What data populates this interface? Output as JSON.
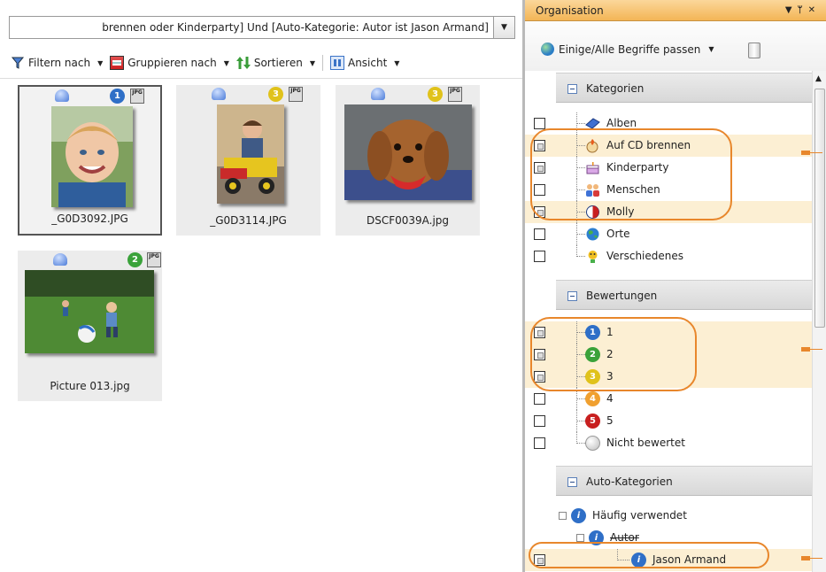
{
  "search": {
    "query": "brennen oder Kinderparty] Und [Auto-Kategorie: Autor ist Jason Armand]"
  },
  "toolbar": {
    "filter_label": "Filtern nach",
    "group_label": "Gruppieren nach",
    "sort_label": "Sortieren",
    "view_label": "Ansicht"
  },
  "photos": [
    {
      "filename": "_G0D3092.JPG",
      "rating": "1",
      "rating_color": "#2f6fc7",
      "selected": true
    },
    {
      "filename": "_G0D3114.JPG",
      "rating": "3",
      "rating_color": "#e0c21b",
      "selected": false
    },
    {
      "filename": "DSCF0039A.jpg",
      "rating": "3",
      "rating_color": "#e0c21b",
      "selected": false
    },
    {
      "filename": "Picture 013.jpg",
      "rating": "2",
      "rating_color": "#3aa23a",
      "selected": false
    }
  ],
  "badges": {
    "jpg": "JPG"
  },
  "panel": {
    "title": "Organisation",
    "match_label": "Einige/Alle Begriffe passen",
    "accent": "#e8872c"
  },
  "sections": {
    "categories": {
      "title": "Kategorien",
      "items": [
        {
          "label": "Alben",
          "icon": "album-icon",
          "highlighted": false,
          "checked": false
        },
        {
          "label": "Auf CD brennen",
          "icon": "burn-cd-icon",
          "highlighted": true,
          "checked": true
        },
        {
          "label": "Kinderparty",
          "icon": "cake-icon",
          "highlighted": false,
          "checked": true
        },
        {
          "label": "Menschen",
          "icon": "people-icon",
          "highlighted": false,
          "checked": false
        },
        {
          "label": "Molly",
          "icon": "molly-icon",
          "highlighted": true,
          "checked": true
        },
        {
          "label": "Orte",
          "icon": "globe-icon",
          "highlighted": false,
          "checked": false
        },
        {
          "label": "Verschiedenes",
          "icon": "misc-icon",
          "highlighted": false,
          "checked": false
        }
      ]
    },
    "ratings": {
      "title": "Bewertungen",
      "items": [
        {
          "label": "1",
          "number": "1",
          "color": "#2f6fc7",
          "checked": true
        },
        {
          "label": "2",
          "number": "2",
          "color": "#3aa23a",
          "checked": true
        },
        {
          "label": "3",
          "number": "3",
          "color": "#e0c21b",
          "checked": true
        },
        {
          "label": "4",
          "number": "4",
          "color": "#f0a030",
          "checked": false
        },
        {
          "label": "5",
          "number": "5",
          "color": "#c81f1f",
          "checked": false
        },
        {
          "label": "Nicht bewertet",
          "number": "",
          "color": "#cfcfcf",
          "checked": false
        }
      ]
    },
    "auto": {
      "title": "Auto-Kategorien",
      "items": [
        {
          "label": "Häufig verwendet"
        },
        {
          "label": "Autor"
        },
        {
          "label": "Jason Armand"
        }
      ]
    }
  }
}
